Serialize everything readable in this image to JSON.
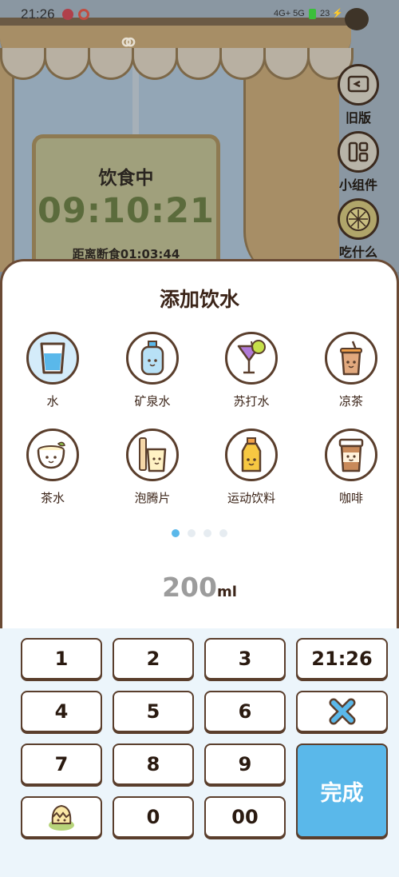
{
  "status_bar": {
    "time": "21:26",
    "network": "4G+ 5G",
    "battery": "23"
  },
  "background": {
    "timer": {
      "title": "饮食中",
      "value": "09:10:21",
      "subtitle": "距离断食01:03:44"
    },
    "side_buttons": [
      {
        "label": "旧版",
        "icon": "back-screen-icon"
      },
      {
        "label": "小组件",
        "icon": "widget-grid-icon"
      },
      {
        "label": "吃什么",
        "icon": "lemon-slice-icon"
      }
    ]
  },
  "sheet": {
    "title": "添加饮水",
    "drinks": [
      {
        "label": "水",
        "icon": "water-glass-icon",
        "selected": true
      },
      {
        "label": "矿泉水",
        "icon": "water-bottle-icon",
        "selected": false
      },
      {
        "label": "苏打水",
        "icon": "soda-glass-icon",
        "selected": false
      },
      {
        "label": "凉茶",
        "icon": "herbal-tea-cup-icon",
        "selected": false
      },
      {
        "label": "茶水",
        "icon": "tea-cup-icon",
        "selected": false
      },
      {
        "label": "泡腾片",
        "icon": "effervescent-tablet-icon",
        "selected": false
      },
      {
        "label": "运动饮料",
        "icon": "sports-drink-bottle-icon",
        "selected": false
      },
      {
        "label": "咖啡",
        "icon": "coffee-cup-icon",
        "selected": false
      }
    ],
    "page_indicator": {
      "pages": 4,
      "current": 1
    },
    "amount": {
      "value": "200",
      "unit": "ml"
    }
  },
  "keypad": {
    "keys": [
      "1",
      "2",
      "3",
      "4",
      "5",
      "6",
      "7",
      "8",
      "9",
      "0",
      "00"
    ],
    "time_key": "21:26",
    "delete_icon": "clear-x-icon",
    "emoji_icon": "egg-chick-icon",
    "done_label": "完成"
  },
  "colors": {
    "accent": "#5ab8ea",
    "outline": "#5a3e2c",
    "keypad_bg": "#ecf5fb",
    "timer_green": "#5b6b3c"
  }
}
